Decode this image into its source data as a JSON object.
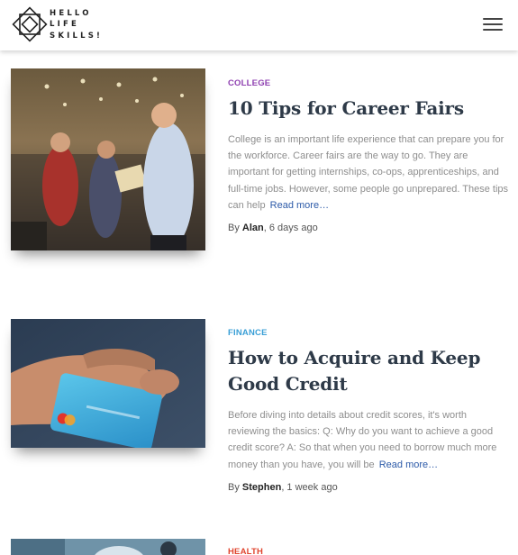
{
  "header": {
    "logo_lines": [
      "HELLO",
      "LIFE",
      "SKILLS!"
    ],
    "menu_icon": "hamburger-icon"
  },
  "articles": [
    {
      "category": "College",
      "category_color": "#8e3fb0",
      "title": "10 Tips for Career Fairs",
      "excerpt": "College is an important life experience that can prepare you for the workforce. Career fairs are the way to go. They are important for getting internships, co-ops, apprenticeships, and full-time jobs. However, some people go unprepared. These tips can help",
      "read_more": "Read more…",
      "by": "By",
      "author": "Alan",
      "time": ", 6 days ago"
    },
    {
      "category": "Finance",
      "category_color": "#3a9fd6",
      "title": "How to Acquire and Keep Good Credit",
      "excerpt": "Before diving into details about credit scores, it's worth reviewing the basics: Q: Why do you want to achieve a good credit score? A: So that when you need to borrow much more money than you have, you will be",
      "read_more": "Read more…",
      "by": "By",
      "author": "Stephen",
      "time": ", 1 week ago"
    },
    {
      "category": "Health",
      "category_color": "#e0452f"
    }
  ]
}
